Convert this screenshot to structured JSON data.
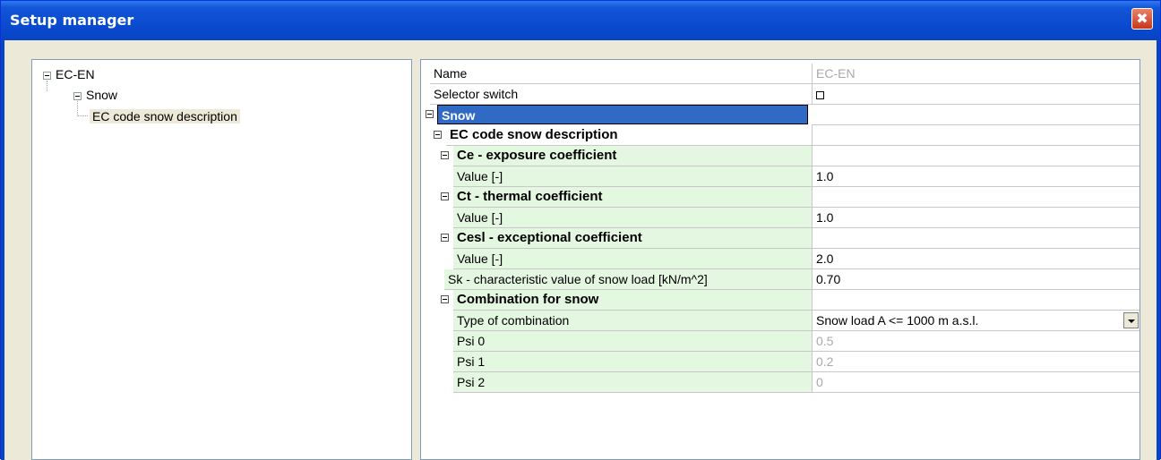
{
  "window": {
    "title": "Setup manager",
    "close_glyph": "✖"
  },
  "tree": {
    "root": "EC-EN",
    "child": "Snow",
    "leaf": "EC code snow description"
  },
  "grid": {
    "name_label": "Name",
    "name_value": "EC-EN",
    "selector_label": "Selector switch",
    "snow_section": "Snow",
    "ec_section": "EC code snow description",
    "ce_section": "Ce - exposure coefficient",
    "ce_value_label": "Value [-]",
    "ce_value": "1.0",
    "ct_section": "Ct - thermal coefficient",
    "ct_value_label": "Value [-]",
    "ct_value": "1.0",
    "cesl_section": "Cesl - exceptional coefficient",
    "cesl_value_label": "Value [-]",
    "cesl_value": "2.0",
    "sk_label": "Sk - characteristic value of snow load [kN/m^2]",
    "sk_value": "0.70",
    "comb_section": "Combination for snow",
    "type_label": "Type of combination",
    "type_value": "Snow load A <= 1000 m a.s.l.",
    "psi0_label": "Psi 0",
    "psi0_value": "0.5",
    "psi1_label": "Psi 1",
    "psi1_value": "0.2",
    "psi2_label": "Psi 2",
    "psi2_value": "0"
  },
  "colors": {
    "titlebar": "#0a4bd0",
    "selection": "#316ac5",
    "green_cell": "#e4f7e1"
  }
}
